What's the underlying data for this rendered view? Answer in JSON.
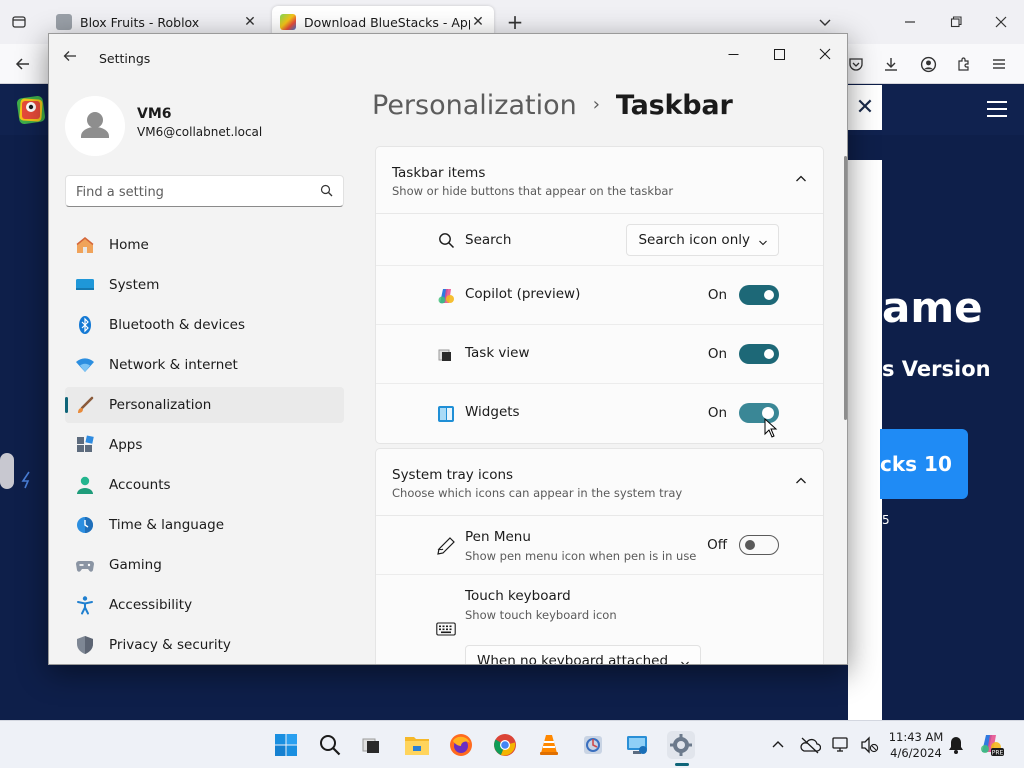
{
  "browser": {
    "tabs": [
      {
        "label": "Blox Fruits - Roblox",
        "close": "✕"
      },
      {
        "label": "Download BlueStacks - App Pla",
        "close": "✕"
      }
    ],
    "new_tab": "+"
  },
  "website": {
    "headline_fragment": "ame",
    "version_fragment": "s Version",
    "cta_fragment": "cks 10",
    "small_fragment": "5",
    "close_glyph": "✕"
  },
  "settings": {
    "window_title": "Settings",
    "profile": {
      "name": "VM6",
      "email": "VM6@collabnet.local"
    },
    "search": {
      "placeholder": "Find a setting"
    },
    "nav": [
      {
        "label": "Home",
        "icon": "home-icon"
      },
      {
        "label": "System",
        "icon": "system-icon"
      },
      {
        "label": "Bluetooth & devices",
        "icon": "bluetooth-icon"
      },
      {
        "label": "Network & internet",
        "icon": "network-icon"
      },
      {
        "label": "Personalization",
        "icon": "personalization-icon",
        "active": true
      },
      {
        "label": "Apps",
        "icon": "apps-icon"
      },
      {
        "label": "Accounts",
        "icon": "accounts-icon"
      },
      {
        "label": "Time & language",
        "icon": "time-language-icon"
      },
      {
        "label": "Gaming",
        "icon": "gaming-icon"
      },
      {
        "label": "Accessibility",
        "icon": "accessibility-icon"
      },
      {
        "label": "Privacy & security",
        "icon": "privacy-icon"
      }
    ],
    "breadcrumb": {
      "parent": "Personalization",
      "separator": "›",
      "current": "Taskbar"
    },
    "taskbar_items": {
      "title": "Taskbar items",
      "subtitle": "Show or hide buttons that appear on the taskbar",
      "search": {
        "label": "Search",
        "value": "Search icon only"
      },
      "copilot": {
        "label": "Copilot (preview)",
        "state": "On"
      },
      "task_view": {
        "label": "Task view",
        "state": "On"
      },
      "widgets": {
        "label": "Widgets",
        "state": "On"
      }
    },
    "system_tray": {
      "title": "System tray icons",
      "subtitle": "Choose which icons can appear in the system tray",
      "pen_menu": {
        "label": "Pen Menu",
        "sub": "Show pen menu icon when pen is in use",
        "state": "Off"
      },
      "touch_keyboard": {
        "label": "Touch keyboard",
        "sub": "Show touch keyboard icon",
        "value": "When no keyboard attached"
      }
    }
  },
  "taskbar": {
    "time": "11:43 AM",
    "date": "4/6/2024"
  },
  "colors": {
    "accent": "#1d6877",
    "web_bg": "#0e1f4a",
    "cta": "#1f8bf5"
  }
}
